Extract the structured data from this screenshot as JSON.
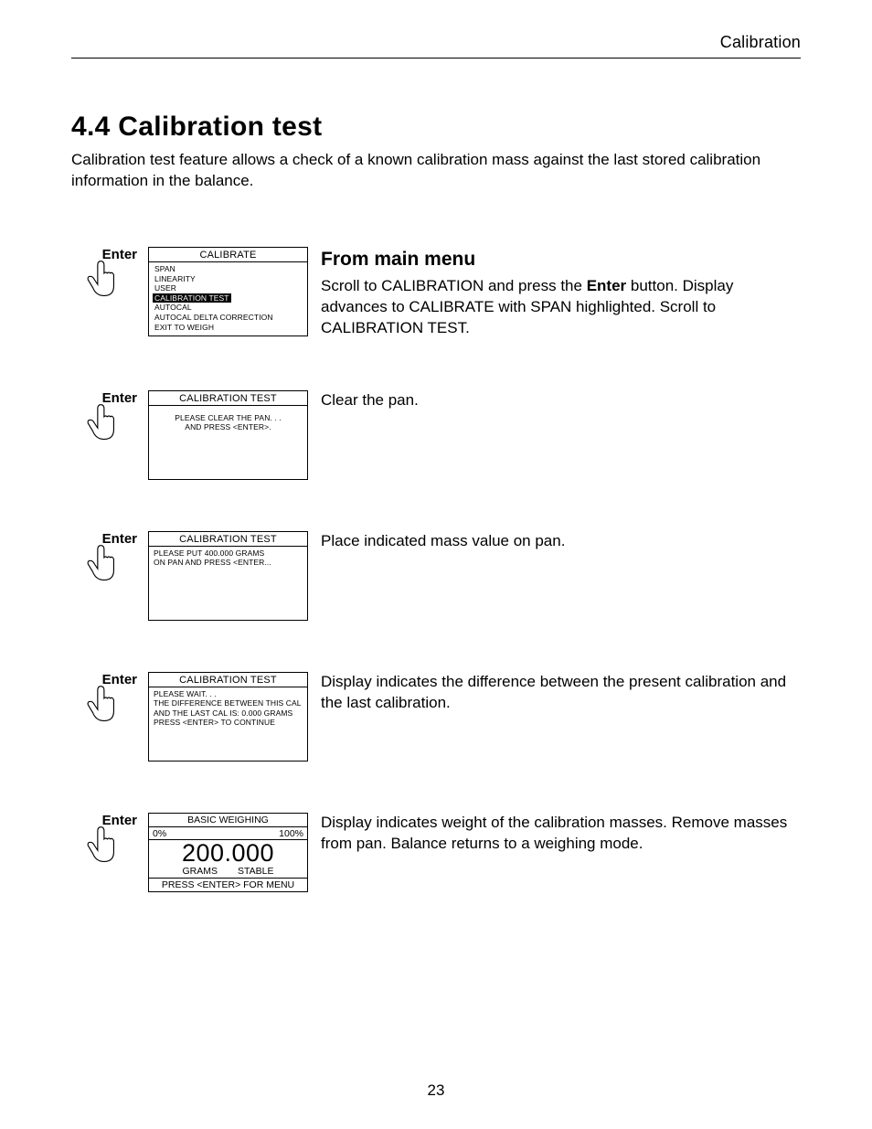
{
  "header": {
    "right": "Calibration"
  },
  "title": "4.4  Calibration test",
  "intro": "Calibration test feature allows a check of a known calibration mass against the last stored calibration information in the balance.",
  "enter_label": "Enter",
  "steps": [
    {
      "screen": {
        "title": "CALIBRATE",
        "menu": [
          {
            "text": "SPAN",
            "hl": false
          },
          {
            "text": "LINEARITY",
            "hl": false
          },
          {
            "text": "USER",
            "hl": false
          },
          {
            "text": "CALIBRATION TEST",
            "hl": true
          },
          {
            "text": "AUTOCAL",
            "hl": false
          },
          {
            "text": "AUTOCAL DELTA CORRECTION",
            "hl": false
          },
          {
            "text": "EXIT TO WEIGH",
            "hl": false
          }
        ]
      },
      "desc": {
        "sub_title": "From main menu",
        "pre": "Scroll to CALIBRATION and press the ",
        "bold": "Enter",
        "post": " button.  Display advances to CALIBRATE with SPAN highlighted.  Scroll to CALIBRATION TEST."
      }
    },
    {
      "screen": {
        "title": "CALIBRATION TEST",
        "lines": [
          "PLEASE CLEAR THE PAN. . .",
          "AND PRESS <ENTER>."
        ],
        "center": true
      },
      "desc": {
        "text": "Clear the pan."
      }
    },
    {
      "screen": {
        "title": "CALIBRATION TEST",
        "lines": [
          "PLEASE PUT 400.000 GRAMS",
          "ON PAN AND PRESS <ENTER..."
        ]
      },
      "desc": {
        "text": "Place indicated mass value on pan."
      }
    },
    {
      "screen": {
        "title": "CALIBRATION TEST",
        "lines": [
          "PLEASE WAIT. . .",
          "THE DIFFERENCE BETWEEN THIS CAL",
          "AND THE LAST CAL IS: 0.000 GRAMS",
          "PRESS <ENTER> TO CONTINUE"
        ]
      },
      "desc": {
        "text": "Display indicates the difference between the present calibration and the last calibration."
      }
    }
  ],
  "weigh_step": {
    "head": "BASIC WEIGHING",
    "pct_low": "0%",
    "pct_high": "100%",
    "value": "200.000",
    "unit": "GRAMS",
    "status": "STABLE",
    "foot": "PRESS <ENTER> FOR MENU",
    "desc": "Display indicates weight of the calibration masses.  Remove masses from pan.  Balance returns to a weighing mode."
  },
  "page_num": "23"
}
